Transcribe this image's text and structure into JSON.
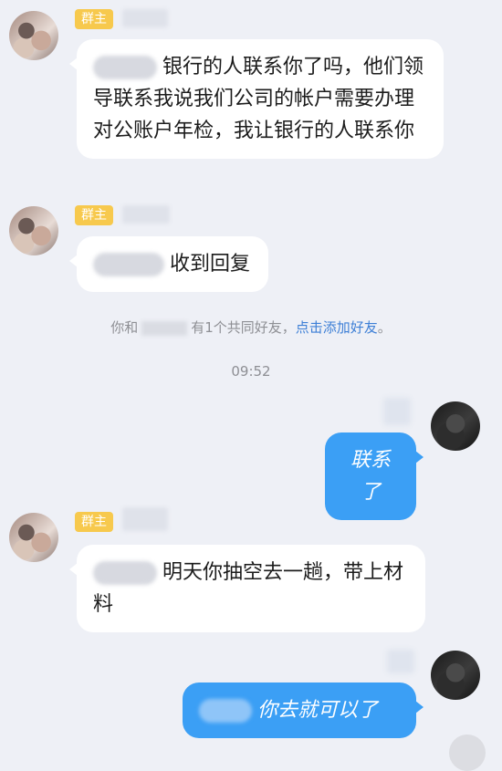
{
  "group_owner_badge": "群主",
  "messages": [
    {
      "from": "left",
      "badge": "群主",
      "text": "银行的人联系你了吗，他们领导联系我说我们公司的帐户需要办理对公账户年检，我让银行的人联系你"
    },
    {
      "from": "left",
      "badge": "群主",
      "text": "收到回复"
    },
    {
      "from": "right",
      "text": "联系了"
    },
    {
      "from": "left",
      "badge": "群主",
      "text": "明天你抽空去一趟，带上材料"
    },
    {
      "from": "right",
      "text": "你去就可以了"
    }
  ],
  "system_notice": {
    "prefix": "你和",
    "middle": "有1个共同好友，",
    "link": "点击添加好友",
    "suffix": "。"
  },
  "timestamp": "09:52",
  "colors": {
    "background": "#eef0f6",
    "sent_bubble": "#3b9ff5",
    "received_bubble": "#ffffff",
    "badge": "#f7c94d",
    "link": "#3d7fd6"
  }
}
